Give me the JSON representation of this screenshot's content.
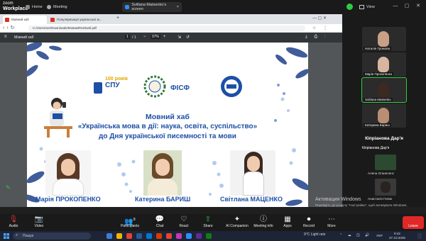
{
  "zoom": {
    "brand_line1": "zoom",
    "brand_line2": "Workplace",
    "tabs": [
      {
        "label": "Home"
      },
      {
        "label": "Meeting"
      },
      {
        "label": "Svitlana Matsenko's screen"
      }
    ],
    "view_label": "View"
  },
  "browser": {
    "tabs": [
      {
        "label": "Мовний хаб"
      },
      {
        "label": "Популяризація української м..."
      }
    ],
    "address": "C:/Users/usr/Downloads/Мовний%20хаб.pdf",
    "pdf_title": "Мовний хаб",
    "page_current": "1",
    "page_total": "/ 1",
    "zoom_level": "97%"
  },
  "slide": {
    "logo_100": "100 років",
    "logo_spu": "СПУ",
    "logo_fisf": "ФІСФ",
    "title_line1": "Мовний хаб",
    "title_line2": "«Українська мова в дії: наука, освіта, суспільство»",
    "title_line3": "до Дня української писемності та мови",
    "names": [
      "Марія ПРОКОПЕНКО",
      "Катерина БАРИШ",
      "Світлана МАЦЕНКО"
    ]
  },
  "participants": {
    "videos": [
      {
        "name": "Наталія Громова"
      },
      {
        "name": "Марія Прокопенко"
      },
      {
        "name": "Svitlana Matsenko"
      },
      {
        "name": "Катерина Бариш"
      }
    ],
    "speaker_name": "Кіпріанова Дар'я",
    "list": [
      {
        "name": "Кіпріанова Дар'я"
      },
      {
        "name": "Алена Оганесянс"
      },
      {
        "name": "Анастасія Гелик"
      }
    ]
  },
  "watermark": {
    "title": "Активация Windows",
    "subtitle": "Перейдіть до розділу \"Настройки\", щоб активувати Windows."
  },
  "bottom_bar": {
    "buttons": [
      {
        "label": "Audio",
        "glyph": "🎤"
      },
      {
        "label": "Video",
        "glyph": "📹"
      },
      {
        "label": "Participants",
        "glyph": "👥",
        "count": "8"
      },
      {
        "label": "Chat",
        "glyph": "💬"
      },
      {
        "label": "React",
        "glyph": "♡"
      },
      {
        "label": "Share",
        "glyph": "⇧"
      },
      {
        "label": "AI Companion",
        "glyph": "✦"
      },
      {
        "label": "Meeting info",
        "glyph": "ⓘ"
      },
      {
        "label": "Apps",
        "glyph": "▦"
      },
      {
        "label": "Record",
        "glyph": "⏺"
      },
      {
        "label": "More",
        "glyph": "⋯"
      }
    ],
    "leave_label": "Leave"
  },
  "taskbar": {
    "search_placeholder": "Пошук",
    "weather": "9°C  Light rain",
    "lang": "УКР",
    "time": "9:42",
    "date": "27.10.2025"
  },
  "colors": {
    "accent_blue": "#1d4fa6",
    "zoom_green": "#2ecc40",
    "leave_red": "#e02828"
  }
}
